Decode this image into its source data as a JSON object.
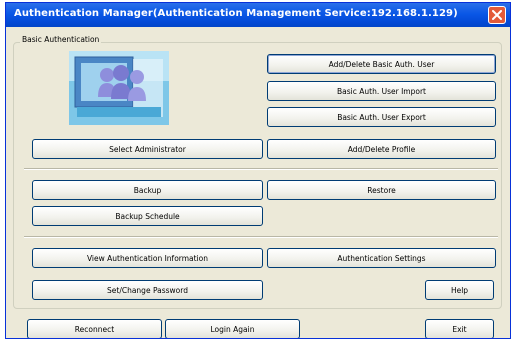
{
  "window": {
    "title": "Authentication Manager(Authentication Management Service:192.168.1.129)"
  },
  "group": {
    "label": "Basic Authentication"
  },
  "buttons": {
    "add_delete_user": "Add/Delete Basic Auth. User",
    "user_import": "Basic Auth. User Import",
    "user_export": "Basic Auth. User Export",
    "select_administrator": "Select Administrator",
    "add_delete_profile": "Add/Delete Profile",
    "backup": "Backup",
    "restore": "Restore",
    "backup_schedule": "Backup Schedule",
    "view_auth_info": "View Authentication Information",
    "auth_settings": "Authentication Settings",
    "set_change_password": "Set/Change Password",
    "help": "Help",
    "reconnect": "Reconnect",
    "login_again": "Login Again",
    "exit": "Exit"
  },
  "icons": {
    "logo": "users-group-icon",
    "close": "close-icon"
  },
  "colors": {
    "titlebar": "#0a57e6",
    "close_button": "#e35b3a",
    "window_bg": "#ece9d8"
  }
}
